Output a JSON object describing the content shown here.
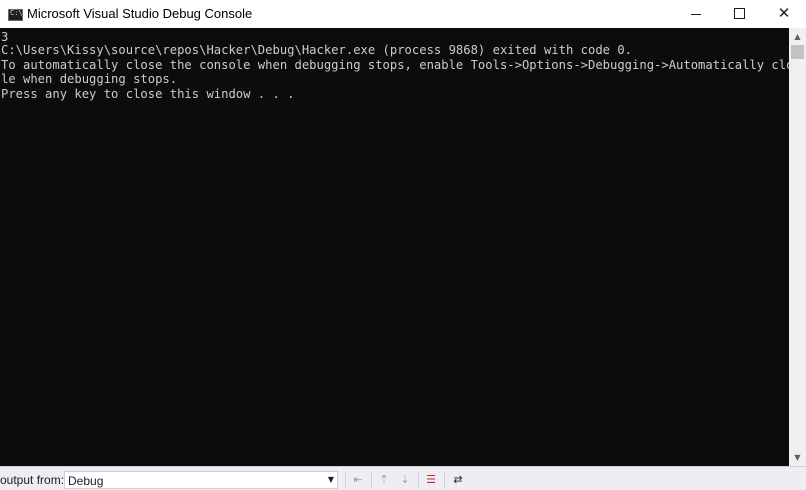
{
  "window": {
    "title": "Microsoft Visual Studio Debug Console",
    "icon_text": "C:\\"
  },
  "titlebar_buttons": {
    "minimize": "minimize-icon",
    "maximize": "maximize-icon",
    "close": "close-icon",
    "close_glyph": "✕"
  },
  "console": {
    "lines": [
      "3",
      "C:\\Users\\Kissy\\source\\repos\\Hacker\\Debug\\Hacker.exe (process 9868) exited with code 0.",
      "To automatically close the console when debugging stops, enable Tools->Options->Debugging->Automatically close the conso",
      "le when debugging stops.",
      "Press any key to close this window . . ."
    ],
    "text_color": "#cccccc",
    "background_color": "#0c0c0c"
  },
  "scrollbar": {
    "up_glyph": "▲",
    "down_glyph": "▼"
  },
  "output_panel": {
    "label": "output from:",
    "selected_source": "Debug",
    "dropdown_glyph": "▼",
    "tools": [
      {
        "name": "find-message-icon",
        "glyph": "⇤"
      },
      {
        "name": "previous-message-icon",
        "glyph": "⇡"
      },
      {
        "name": "next-message-icon",
        "glyph": "⇣"
      },
      {
        "name": "clear-all-icon",
        "glyph": "☰"
      },
      {
        "name": "toggle-word-wrap-icon",
        "glyph": "⇄"
      }
    ]
  }
}
